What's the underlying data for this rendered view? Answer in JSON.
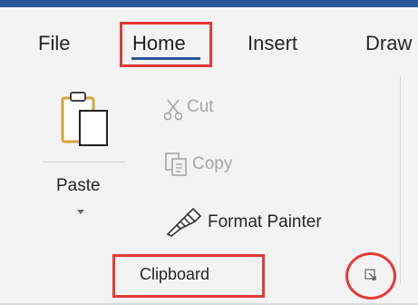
{
  "tabs": {
    "file": "File",
    "home": "Home",
    "insert": "Insert",
    "draw": "Draw"
  },
  "clipboard": {
    "paste_label": "Paste",
    "cut_label": "Cut",
    "copy_label": "Copy",
    "format_painter_label": "Format Painter",
    "group_label": "Clipboard"
  },
  "icons": {
    "paste": "clipboard-paste-icon",
    "cut": "scissors-icon",
    "copy": "copy-icon",
    "format_painter": "paintbrush-icon",
    "launcher": "dialog-launcher-icon",
    "paste_dropdown": "chevron-down-icon"
  },
  "colors": {
    "accent": "#2b579a",
    "highlight": "#e53935",
    "disabled_text": "#a6a6a6",
    "ribbon_bg": "#f3f3f3"
  }
}
